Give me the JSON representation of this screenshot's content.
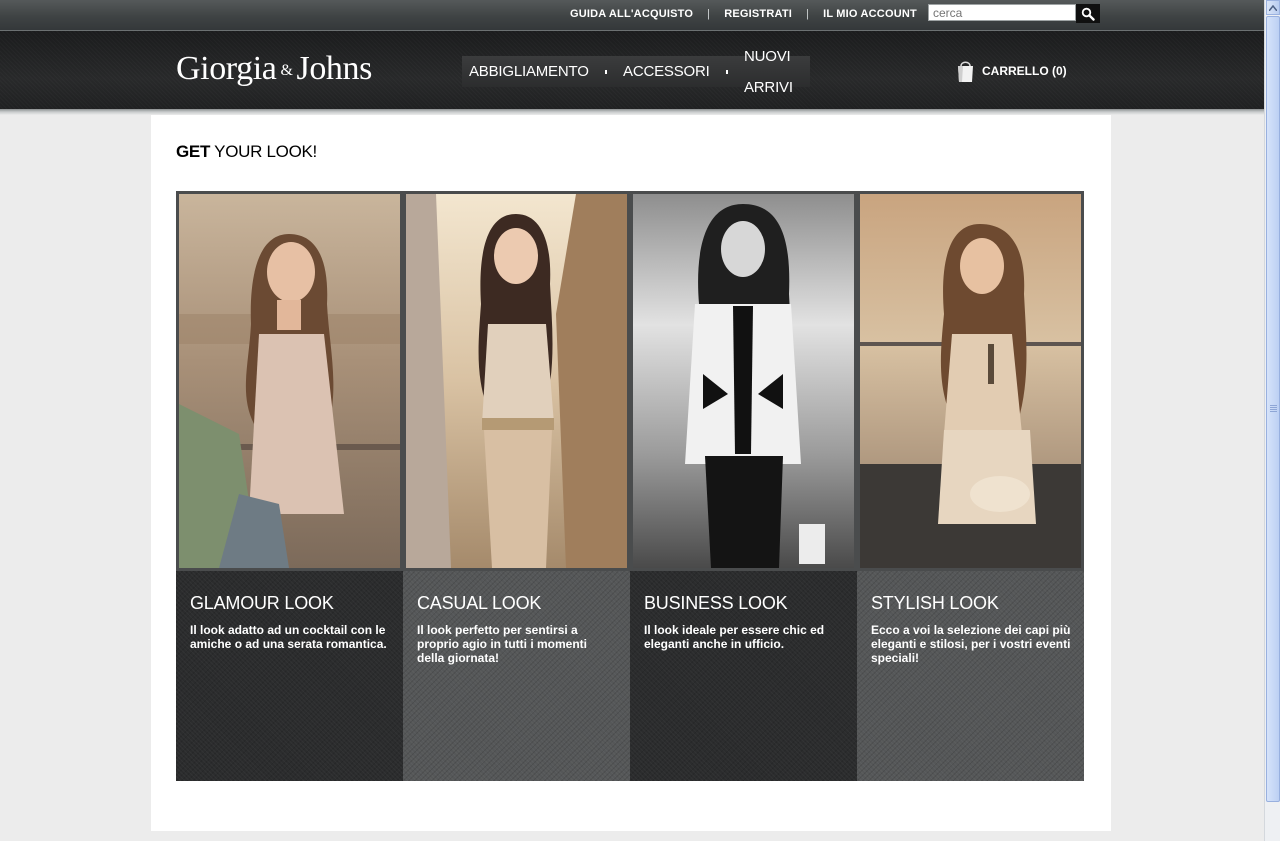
{
  "topbar": {
    "links": [
      "GUIDA ALL'ACQUISTO",
      "REGISTRATI",
      "IL MIO ACCOUNT"
    ],
    "separator": "|",
    "search_placeholder": "cerca"
  },
  "header": {
    "logo": {
      "part1": "Giorgia",
      "amp": "&",
      "part2": "Johns"
    },
    "nav": [
      "ABBIGLIAMENTO",
      "ACCESSORI",
      "NUOVI ARRIVI"
    ],
    "cart_label": "CARRELLO (0)"
  },
  "main": {
    "heading_bold": "GET",
    "heading_rest": " YOUR LOOK!",
    "looks": [
      {
        "title": "GLAMOUR LOOK",
        "text": "Il look adatto ad un cocktail con le amiche o ad una serata romantica."
      },
      {
        "title": "CASUAL LOOK",
        "text": "Il look perfetto per sentirsi a proprio agio in tutti i momenti della giornata!"
      },
      {
        "title": "BUSINESS LOOK",
        "text": "Il look ideale per essere chic ed eleganti anche in ufficio."
      },
      {
        "title": "STYLISH LOOK",
        "text": "Ecco a voi la selezione dei capi più eleganti e stilosi, per i vostri eventi speciali!"
      }
    ]
  },
  "icons": {
    "search": "magnifier-icon",
    "cart": "shopping-bag-icon",
    "scroll_up": "arrow-up-icon"
  }
}
